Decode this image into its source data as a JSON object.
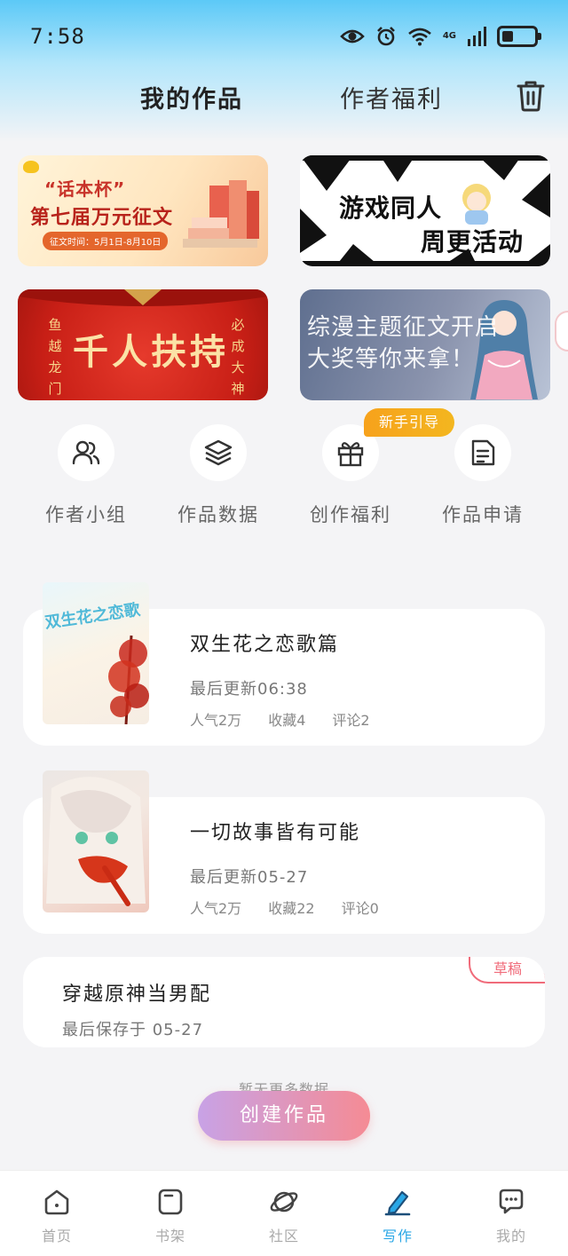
{
  "status_bar": {
    "time": "7:58",
    "network": "4G"
  },
  "header": {
    "tab_works": "我的作品",
    "tab_benefits": "作者福利"
  },
  "banners": [
    {
      "cup": "“话本杯”",
      "title": "第七届万元征文",
      "time": "征文时间：5月1日-8月10日"
    },
    {
      "line1": "游戏同人",
      "line2": "周更活动"
    },
    {
      "title": "千人扶持",
      "left_text": "鱼越龙门",
      "right_text": "必成大神"
    },
    {
      "line1": "综漫主题征文开启",
      "line2": "大奖等你来拿！"
    }
  ],
  "new_badge": "新手引导",
  "tools": [
    {
      "label": "作者小组",
      "icon": "group-icon"
    },
    {
      "label": "作品数据",
      "icon": "layers-icon"
    },
    {
      "label": "创作福利",
      "icon": "gift-icon"
    },
    {
      "label": "作品申请",
      "icon": "document-icon"
    }
  ],
  "works": [
    {
      "cover_text": "双生花之恋歌",
      "title": "双生花之恋歌篇",
      "update": "最后更新06:38",
      "popularity": "人气2万",
      "favorites": "收藏4",
      "comments": "评论2"
    },
    {
      "title": "一切故事皆有可能",
      "update": "最后更新05-27",
      "popularity": "人气2万",
      "favorites": "收藏22",
      "comments": "评论0"
    }
  ],
  "draft": {
    "title": "穿越原神当男配",
    "saved": "最后保存于 05-27",
    "badge": "草稿"
  },
  "no_more": "暂无更多数据",
  "create_button": "创建作品",
  "tabbar": [
    {
      "label": "首页",
      "icon": "home-icon",
      "active": false
    },
    {
      "label": "书架",
      "icon": "bookshelf-icon",
      "active": false
    },
    {
      "label": "社区",
      "icon": "planet-icon",
      "active": false
    },
    {
      "label": "写作",
      "icon": "pen-icon",
      "active": true
    },
    {
      "label": "我的",
      "icon": "chat-icon",
      "active": false
    }
  ],
  "colors": {
    "accent_blue": "#2aa7e6",
    "draft_red": "#f06b7a",
    "badge_orange": "#f7a21c"
  }
}
